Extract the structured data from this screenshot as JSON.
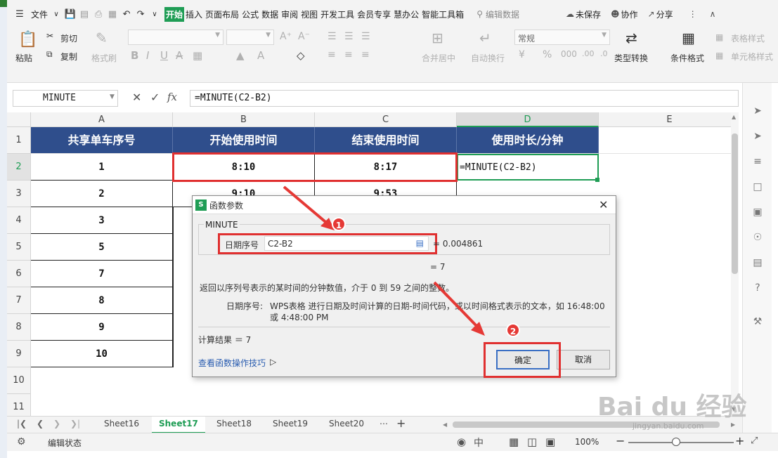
{
  "menu": {
    "file": "文件",
    "tabs": [
      "开始",
      "插入",
      "页面布局",
      "公式",
      "数据",
      "审阅",
      "视图",
      "开发工具",
      "会员专享",
      "慧办公",
      "智能工具箱"
    ],
    "active_tab": "开始",
    "search": "编辑数据",
    "unsaved": "未保存",
    "collab": "协作",
    "share": "分享"
  },
  "ribbon": {
    "paste": "粘贴",
    "cut": "剪切",
    "copy": "复制",
    "format_painter": "格式刷",
    "merge_center": "合并居中",
    "wrap_text": "自动换行",
    "number_format": "常规",
    "type_convert": "类型转换",
    "cond_format": "条件格式",
    "table_style": "表格样式",
    "cell_style": "单元格样式"
  },
  "formula_bar": {
    "name_box": "MINUTE",
    "formula": "=MINUTE(C2-B2)"
  },
  "grid": {
    "columns": [
      "A",
      "B",
      "C",
      "D",
      "E"
    ],
    "rows": [
      "1",
      "2",
      "3",
      "4",
      "5",
      "6",
      "7",
      "8",
      "9",
      "10",
      "11"
    ],
    "headers": [
      "共享单车序号",
      "开始使用时间",
      "结束使用时间",
      "使用时长/分钟"
    ],
    "col_a": [
      "1",
      "2",
      "3",
      "5",
      "7",
      "8",
      "9",
      "10"
    ],
    "b2": "8:10",
    "b3": "9:10",
    "c2": "8:17",
    "c3": "9:53",
    "d2": "=MINUTE(C2-B2)"
  },
  "dialog": {
    "title": "函数参数",
    "func_name": "MINUTE",
    "arg_label": "日期序号",
    "arg_value": "C2-B2",
    "arg_result": "= 0.004861",
    "func_result": "= 7",
    "description": "返回以序列号表示的某时间的分钟数值，介于 0 到 59 之间的整数。",
    "arg_help_label": "日期序号:",
    "arg_help_1": "WPS表格 进行日期及时间计算的日期-时间代码，或以时间格式表示的文本，如 16:48:00",
    "arg_help_2": "或 4:48:00 PM",
    "calc_result": "计算结果 ＝ 7",
    "help_link": "查看函数操作技巧",
    "ok": "确定",
    "cancel": "取消",
    "callout1": "1",
    "callout2": "2"
  },
  "sheets": {
    "tabs": [
      "Sheet16",
      "Sheet17",
      "Sheet18",
      "Sheet19",
      "Sheet20"
    ],
    "active": "Sheet17"
  },
  "status": {
    "mode": "编辑状态",
    "zoom": "100%"
  },
  "watermark": {
    "brand": "Bai du 经验",
    "url": "jingyan.baidu.com"
  },
  "colors": {
    "header_fill": "#2f4e8c",
    "active_tab": "#1f9d55",
    "highlight": "#e03030"
  }
}
